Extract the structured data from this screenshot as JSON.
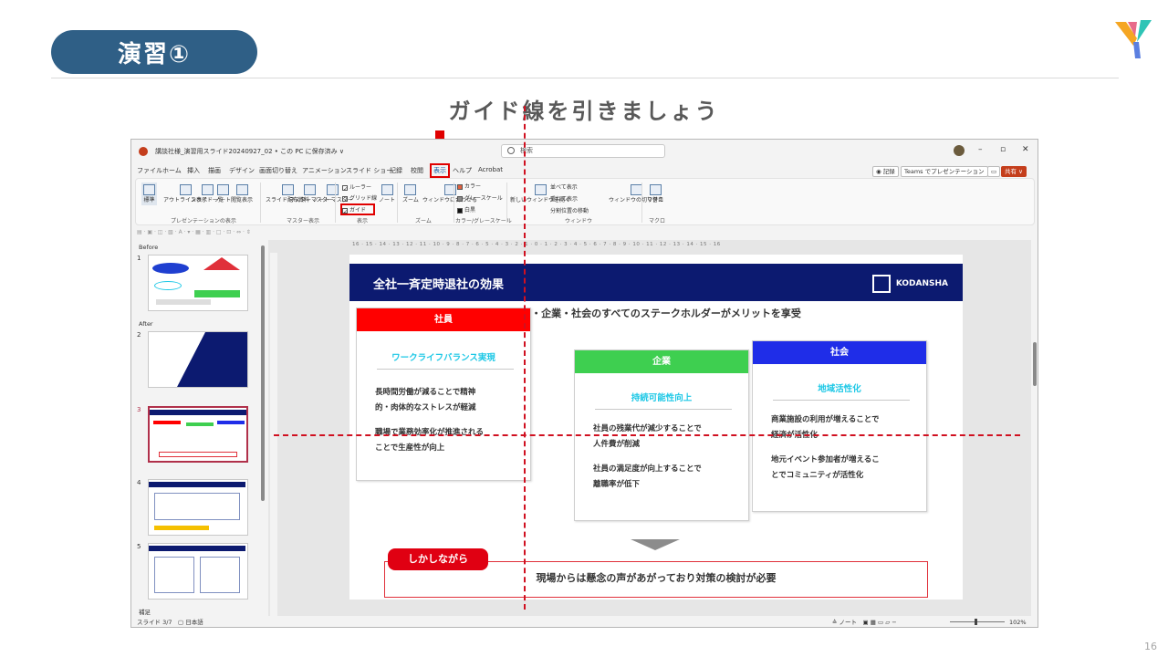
{
  "header": {
    "title": "演習①",
    "subtitle": "ガイド線を引きましょう",
    "page_number": "16"
  },
  "colors": {
    "accent_pill": "#2f5f86",
    "slide_header": "#0c1a70",
    "guide_red": "#d01020",
    "employee": "#ff0000",
    "company": "#3ecf50",
    "society": "#1f2de8",
    "subheading": "#1ec8e6"
  },
  "window": {
    "doc_title": "講談社様_演習用スライド20240927_02 • この PC に保存済み ∨",
    "search_placeholder": "検索",
    "menu": [
      "ファイル",
      "ホーム",
      "挿入",
      "描画",
      "デザイン",
      "画面切り替え",
      "アニメーション",
      "スライド ショー",
      "記録",
      "校閲",
      "表示",
      "ヘルプ",
      "Acrobat"
    ],
    "active_menu": "表示",
    "right_buttons": {
      "record": "◉ 記録",
      "teams": "Teams でプレゼンテーション",
      "share": "共有 ∨"
    },
    "ribbon": {
      "presentation_views": [
        "標準",
        "アウトライン表示",
        "スライド一覧",
        "ノート",
        "閲覧表示"
      ],
      "presentation_views_label": "プレゼンテーションの表示",
      "master_views": [
        "スライド マスター",
        "配布資料 マスター",
        "ノート マスター"
      ],
      "master_views_label": "マスター表示",
      "show": [
        "ルーラー",
        "グリッド線",
        "ガイド"
      ],
      "show_notes": "ノート",
      "show_label": "表示",
      "zoom": [
        "ズーム",
        "ウィンドウに合わせる"
      ],
      "zoom_label": "ズーム",
      "color": [
        "カラー",
        "グレースケール",
        "白黒"
      ],
      "color_label": "カラー/グレースケール",
      "window": [
        "新しいウィンドウを開く",
        "並べて表示",
        "重ねて表示",
        "分割位置の移動"
      ],
      "window_label": "ウィンドウ",
      "switch_window": "ウィンドウの切り替え",
      "macro": "マクロ",
      "macro_label": "マクロ"
    },
    "ruler_text": "16 · 15 · 14 · 13 · 12 · 11 · 10 · 9 · 8 · 7 · 6 · 5 · 4 · 3 · 2 · 1 · 0 · 1 · 2 · 3 · 4 · 5 · 6 · 7 · 8 · 9 · 10 · 11 · 12 · 13 · 14 · 15 · 16",
    "thumbnails": {
      "section_before": "Before",
      "section_after": "After",
      "section_supplement": "補足",
      "numbers": [
        "1",
        "2",
        "3",
        "4",
        "5"
      ]
    },
    "status": {
      "slide": "スライド 3/7",
      "language": "日本語",
      "notes": "ノート",
      "zoom": "102%"
    }
  },
  "slide": {
    "title": "全社一斉定時退社の効果",
    "brand": "KODANSHA",
    "subtitle": "社員・企業・社会のすべてのステークホルダーがメリットを享受",
    "cards": [
      {
        "head": "社員",
        "sub": "ワークライフバランス実現",
        "lines": [
          "長時間労働が減ることで精神",
          "的・肉体的なストレスが軽減",
          "職場で業務効率化が推進される",
          "ことで生産性が向上"
        ]
      },
      {
        "head": "企業",
        "sub": "持続可能性向上",
        "lines": [
          "社員の残業代が減少することで",
          "人件費が削減",
          "社員の満足度が向上することで",
          "離職率が低下"
        ]
      },
      {
        "head": "社会",
        "sub": "地域活性化",
        "lines": [
          "商業施設の利用が増えることで",
          "経済が活性化",
          "地元イベント参加者が増えるこ",
          "とでコミュニティが活性化"
        ]
      }
    ],
    "however": "しかしながら",
    "conclusion": "現場からは懸念の声があがっており対策の検討が必要"
  }
}
